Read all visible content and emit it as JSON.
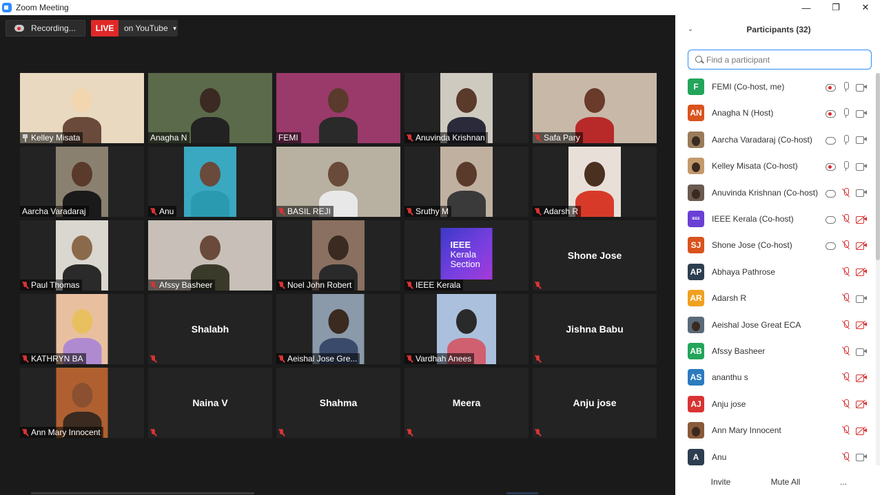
{
  "window": {
    "title": "Zoom Meeting",
    "minimize": "—",
    "maximize": "❐",
    "close": "✕"
  },
  "toolbar": {
    "recording_label": "Recording...",
    "live_label": "LIVE",
    "live_target": "on YouTube"
  },
  "tiles": [
    {
      "name": "Kelley Misata",
      "mic": "pinned",
      "video": true
    },
    {
      "name": "Anagha N",
      "mic": "on",
      "video": true,
      "active": true
    },
    {
      "name": "FEMI",
      "mic": "on",
      "video": true
    },
    {
      "name": "Anuvinda Krishnan",
      "mic": "muted",
      "video": true
    },
    {
      "name": "Safa Pary",
      "mic": "muted",
      "video": true
    },
    {
      "name": "Aarcha Varadaraj",
      "mic": "on",
      "video": true
    },
    {
      "name": "Anu",
      "mic": "muted",
      "video": true
    },
    {
      "name": "BASIL REJI",
      "mic": "muted",
      "video": true
    },
    {
      "name": "Sruthy M",
      "mic": "muted",
      "video": true
    },
    {
      "name": "Adarsh R",
      "mic": "muted",
      "video": true
    },
    {
      "name": "Paul Thomas",
      "mic": "muted",
      "video": true
    },
    {
      "name": "Afssy Basheer",
      "mic": "muted",
      "video": true
    },
    {
      "name": "Noel John Robert",
      "mic": "muted",
      "video": true
    },
    {
      "name": "IEEE Kerala",
      "mic": "muted",
      "video": true,
      "logo": true
    },
    {
      "name": "Shone Jose",
      "mic": "muted",
      "video": false
    },
    {
      "name": "KATHRYN BA",
      "mic": "muted",
      "video": true
    },
    {
      "name": "Shalabh",
      "mic": "muted",
      "video": false
    },
    {
      "name": "Aeishal Jose Gre...",
      "mic": "muted",
      "video": true
    },
    {
      "name": "Vardhah Anees",
      "mic": "muted",
      "video": true
    },
    {
      "name": "Jishna Babu",
      "mic": "muted",
      "video": false
    },
    {
      "name": "Ann Mary Innocent",
      "mic": "muted",
      "video": true
    },
    {
      "name": "Naina V",
      "mic": "muted",
      "video": false
    },
    {
      "name": "Shahma",
      "mic": "muted",
      "video": false
    },
    {
      "name": "Meera",
      "mic": "muted",
      "video": false
    },
    {
      "name": "Anju jose",
      "mic": "muted",
      "video": false
    }
  ],
  "ieee_logo": {
    "line1": "IEEE",
    "line2": "Kerala",
    "line3": "Section"
  },
  "panel": {
    "title": "Participants (32)",
    "search_placeholder": "Find a participant",
    "participants": [
      {
        "name": "FEMI (Co-host, me)",
        "initials": "F",
        "color": "#23a55a",
        "cloud": "rec",
        "mic": "on",
        "cam": "on"
      },
      {
        "name": "Anagha N  (Host)",
        "initials": "AN",
        "color": "#d9531e",
        "cloud": "rec",
        "mic": "on",
        "cam": "on"
      },
      {
        "name": "Aarcha Varadaraj (Co-host)",
        "initials": "",
        "color": "#9a7b5a",
        "photo": true,
        "cloud": "plain",
        "mic": "on",
        "cam": "on"
      },
      {
        "name": "Kelley Misata (Co-host)",
        "initials": "",
        "color": "#c49a6c",
        "photo": true,
        "cloud": "rec",
        "mic": "on",
        "cam": "on"
      },
      {
        "name": "Anuvinda Krishnan (Co-host)",
        "initials": "",
        "color": "#6a5a50",
        "photo": true,
        "cloud": "plain",
        "mic": "muted",
        "cam": "on"
      },
      {
        "name": "IEEE Kerala (Co-host)",
        "initials": "",
        "color": "#6a3fd6",
        "logo": true,
        "cloud": "plain",
        "mic": "muted",
        "cam": "off"
      },
      {
        "name": "Shone Jose (Co-host)",
        "initials": "SJ",
        "color": "#d9531e",
        "cloud": "plain",
        "mic": "muted",
        "cam": "off"
      },
      {
        "name": "Abhaya Pathrose",
        "initials": "AP",
        "color": "#2d3e50",
        "cloud": "none",
        "mic": "muted",
        "cam": "off"
      },
      {
        "name": "Adarsh R",
        "initials": "AR",
        "color": "#f0a020",
        "cloud": "none",
        "mic": "muted",
        "cam": "on"
      },
      {
        "name": "Aeishal Jose Great ECA",
        "initials": "",
        "color": "#5a6a7a",
        "photo": true,
        "cloud": "none",
        "mic": "muted",
        "cam": "off"
      },
      {
        "name": "Afssy Basheer",
        "initials": "AB",
        "color": "#23a55a",
        "cloud": "none",
        "mic": "muted",
        "cam": "on"
      },
      {
        "name": "ananthu s",
        "initials": "AS",
        "color": "#2b7bbf",
        "cloud": "none",
        "mic": "muted",
        "cam": "off"
      },
      {
        "name": "Anju jose",
        "initials": "AJ",
        "color": "#d93333",
        "cloud": "none",
        "mic": "muted",
        "cam": "off"
      },
      {
        "name": "Ann Mary Innocent",
        "initials": "",
        "color": "#8a5a3a",
        "photo": true,
        "cloud": "none",
        "mic": "muted",
        "cam": "off"
      },
      {
        "name": "Anu",
        "initials": "A",
        "color": "#2d3e50",
        "cloud": "none",
        "mic": "muted",
        "cam": "on"
      }
    ],
    "invite_label": "Invite",
    "mute_all_label": "Mute All",
    "more_label": "..."
  }
}
